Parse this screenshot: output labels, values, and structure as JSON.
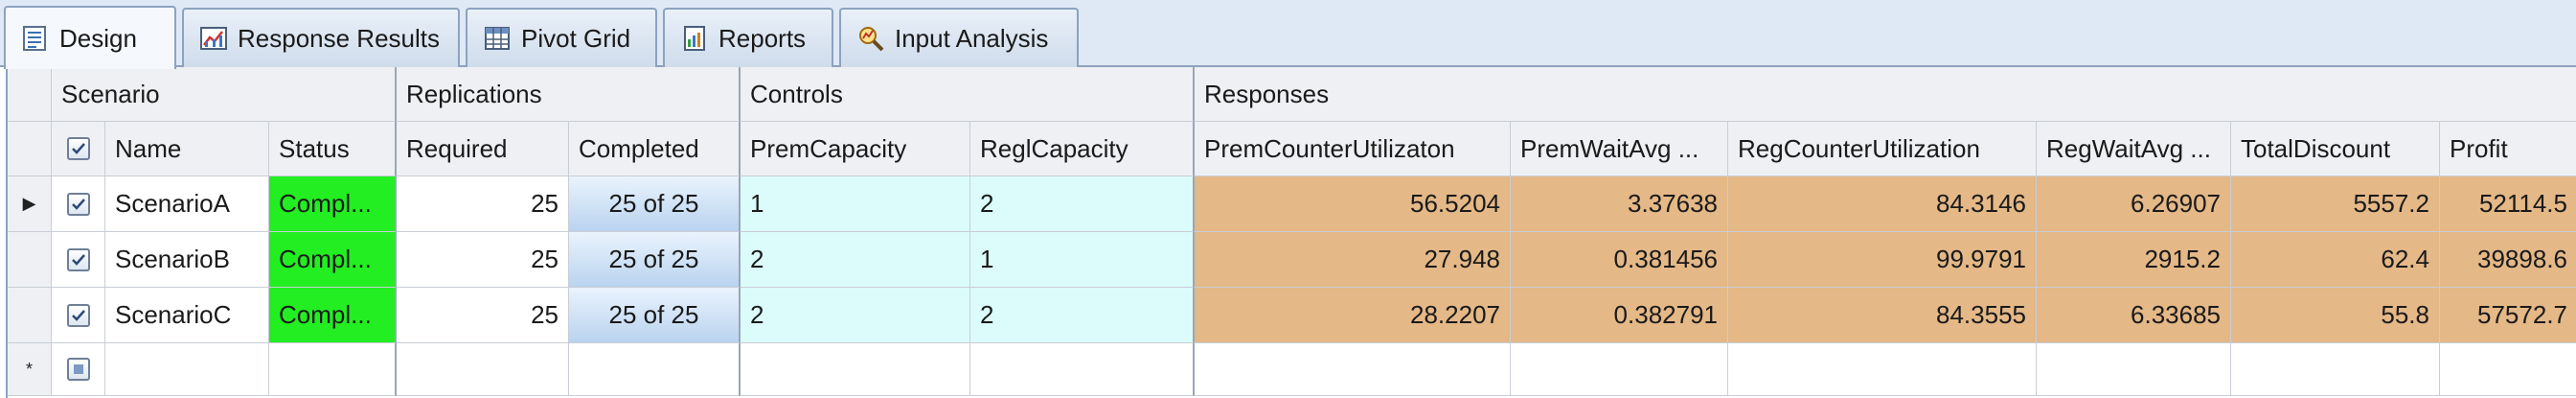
{
  "tabs": [
    {
      "label": "Design",
      "icon": "design-icon",
      "active": true
    },
    {
      "label": "Response Results",
      "icon": "response-chart-icon",
      "active": false
    },
    {
      "label": "Pivot Grid",
      "icon": "pivot-grid-icon",
      "active": false
    },
    {
      "label": "Reports",
      "icon": "reports-icon",
      "active": false
    },
    {
      "label": "Input Analysis",
      "icon": "input-analysis-icon",
      "active": false
    }
  ],
  "bands": {
    "scenario": "Scenario",
    "replications": "Replications",
    "controls": "Controls",
    "responses": "Responses"
  },
  "columns": {
    "name": "Name",
    "status": "Status",
    "required": "Required",
    "completed": "Completed",
    "prem_capacity": "PremCapacity",
    "regl_capacity": "ReglCapacity",
    "prem_counter_util": "PremCounterUtilizaton",
    "prem_wait_avg": "PremWaitAvg ...",
    "reg_counter_util": "RegCounterUtilization",
    "reg_wait_avg": "RegWaitAvg ...",
    "total_discount": "TotalDiscount",
    "profit": "Profit"
  },
  "rows": [
    {
      "checked": true,
      "name": "ScenarioA",
      "status": "Compl...",
      "required": "25",
      "completed": "25 of 25",
      "prem_capacity": "1",
      "regl_capacity": "2",
      "prem_counter_util": "56.5204",
      "prem_wait_avg": "3.37638",
      "reg_counter_util": "84.3146",
      "reg_wait_avg": "6.26907",
      "total_discount": "5557.2",
      "profit": "52114.5"
    },
    {
      "checked": true,
      "name": "ScenarioB",
      "status": "Compl...",
      "required": "25",
      "completed": "25 of 25",
      "prem_capacity": "2",
      "regl_capacity": "1",
      "prem_counter_util": "27.948",
      "prem_wait_avg": "0.381456",
      "reg_counter_util": "99.9791",
      "reg_wait_avg": "2915.2",
      "total_discount": "62.4",
      "profit": "39898.6"
    },
    {
      "checked": true,
      "name": "ScenarioC",
      "status": "Compl...",
      "required": "25",
      "completed": "25 of 25",
      "prem_capacity": "2",
      "regl_capacity": "2",
      "prem_counter_util": "28.2207",
      "prem_wait_avg": "0.382791",
      "reg_counter_util": "84.3555",
      "reg_wait_avg": "6.33685",
      "total_discount": "55.8",
      "profit": "57572.7"
    }
  ],
  "new_row": {
    "indicator": "*"
  },
  "current_row_indicator": "▶",
  "colors": {
    "status_completed": "#22ee22",
    "controls_bg": "#dcfbfb",
    "responses_bg": "#e4b887",
    "header_bg": "#eef0f3"
  }
}
